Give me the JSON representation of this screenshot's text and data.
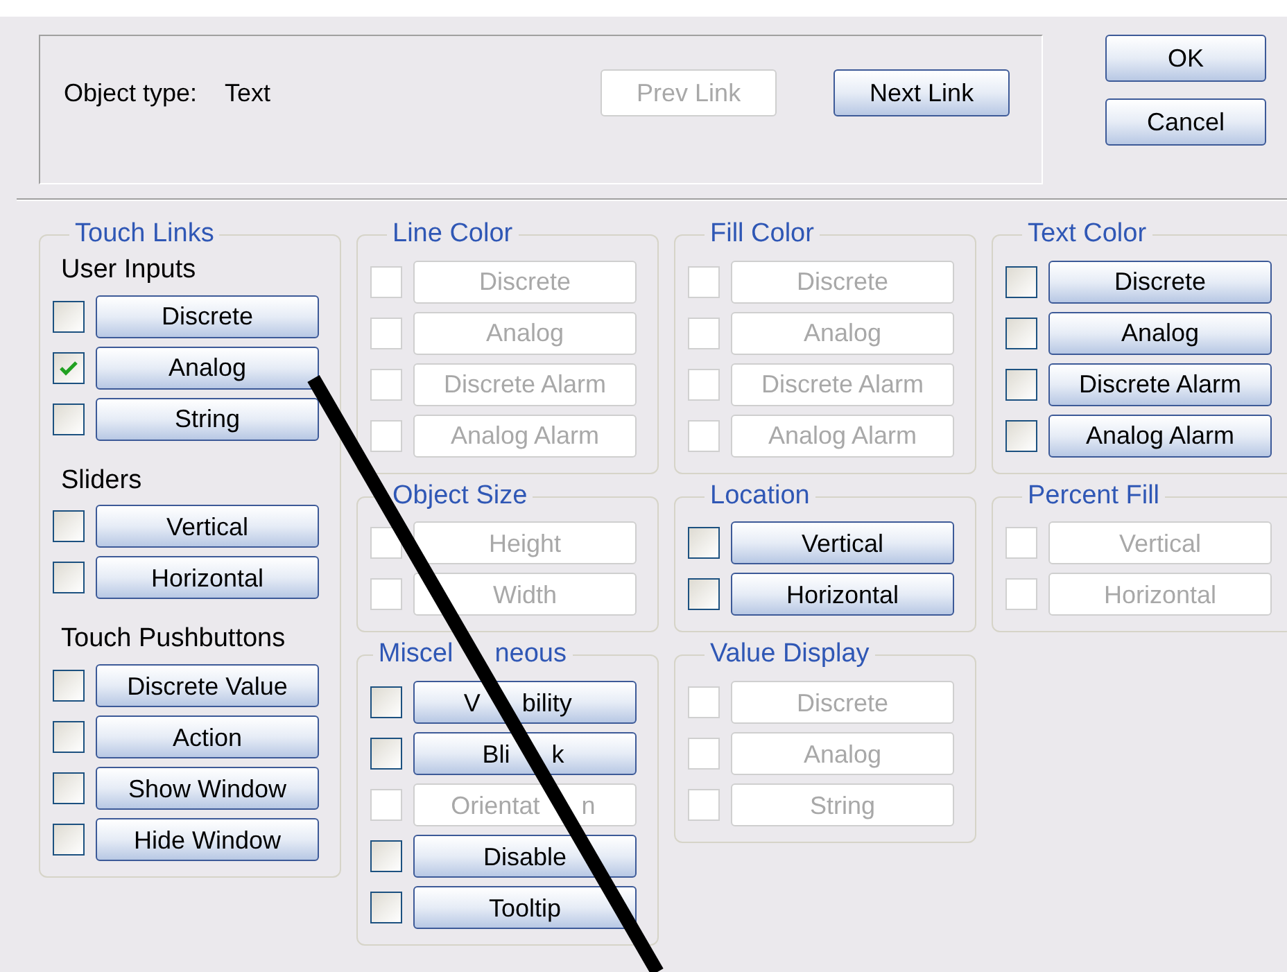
{
  "header": {
    "object_type_label": "Object type:",
    "object_type_value": "Text",
    "link_buttons": [
      {
        "label": "Prev Link",
        "disabled": true
      },
      {
        "label": "Next Link",
        "disabled": false
      }
    ]
  },
  "dialog_buttons": [
    "OK",
    "Cancel"
  ],
  "columns": [
    [
      {
        "title": "Touch Links",
        "sections": [
          {
            "heading": "User Inputs",
            "items": [
              {
                "label": "Discrete",
                "checked": false,
                "disabled": false
              },
              {
                "label": "Analog",
                "checked": true,
                "disabled": false
              },
              {
                "label": "String",
                "checked": false,
                "disabled": false
              }
            ]
          },
          {
            "heading": "Sliders",
            "items": [
              {
                "label": "Vertical",
                "checked": false,
                "disabled": false
              },
              {
                "label": "Horizontal",
                "checked": false,
                "disabled": false
              }
            ]
          },
          {
            "heading": "Touch Pushbuttons",
            "items": [
              {
                "label": "Discrete Value",
                "checked": false,
                "disabled": false
              },
              {
                "label": "Action",
                "checked": false,
                "disabled": false
              },
              {
                "label": "Show Window",
                "checked": false,
                "disabled": false
              },
              {
                "label": "Hide Window",
                "checked": false,
                "disabled": false
              }
            ]
          }
        ]
      }
    ],
    [
      {
        "title": "Line Color",
        "sections": [
          {
            "items": [
              {
                "label": "Discrete",
                "checked": false,
                "disabled": true
              },
              {
                "label": "Analog",
                "checked": false,
                "disabled": true
              },
              {
                "label": "Discrete Alarm",
                "checked": false,
                "disabled": true
              },
              {
                "label": "Analog Alarm",
                "checked": false,
                "disabled": true
              }
            ]
          }
        ]
      },
      {
        "title": "Object Size",
        "sections": [
          {
            "items": [
              {
                "label": "Height",
                "checked": false,
                "disabled": true
              },
              {
                "label": "Width",
                "checked": false,
                "disabled": true
              }
            ]
          }
        ]
      },
      {
        "title_parts": [
          "Miscel",
          "neous"
        ],
        "sections": [
          {
            "items": [
              {
                "label_parts": [
                  "V",
                  "bility"
                ],
                "checked": false,
                "disabled": false
              },
              {
                "label_parts": [
                  "Bli",
                  "k"
                ],
                "checked": false,
                "disabled": false
              },
              {
                "label_parts": [
                  "Orientat",
                  "n"
                ],
                "checked": false,
                "disabled": true
              },
              {
                "label": "Disable",
                "checked": false,
                "disabled": false
              },
              {
                "label": "Tooltip",
                "checked": false,
                "disabled": false
              }
            ]
          }
        ]
      }
    ],
    [
      {
        "title": "Fill Color",
        "sections": [
          {
            "items": [
              {
                "label": "Discrete",
                "checked": false,
                "disabled": true
              },
              {
                "label": "Analog",
                "checked": false,
                "disabled": true
              },
              {
                "label": "Discrete Alarm",
                "checked": false,
                "disabled": true
              },
              {
                "label": "Analog Alarm",
                "checked": false,
                "disabled": true
              }
            ]
          }
        ]
      },
      {
        "title": "Location",
        "sections": [
          {
            "items": [
              {
                "label": "Vertical",
                "checked": false,
                "disabled": false
              },
              {
                "label": "Horizontal",
                "checked": false,
                "disabled": false
              }
            ]
          }
        ]
      },
      {
        "title": "Value Display",
        "sections": [
          {
            "items": [
              {
                "label": "Discrete",
                "checked": false,
                "disabled": true
              },
              {
                "label": "Analog",
                "checked": false,
                "disabled": true
              },
              {
                "label": "String",
                "checked": false,
                "disabled": true
              }
            ]
          }
        ]
      }
    ],
    [
      {
        "title": "Text Color",
        "sections": [
          {
            "items": [
              {
                "label": "Discrete",
                "checked": false,
                "disabled": false
              },
              {
                "label": "Analog",
                "checked": false,
                "disabled": false
              },
              {
                "label": "Discrete Alarm",
                "checked": false,
                "disabled": false
              },
              {
                "label": "Analog Alarm",
                "checked": false,
                "disabled": false
              }
            ]
          }
        ]
      },
      {
        "title": "Percent Fill",
        "sections": [
          {
            "items": [
              {
                "label": "Vertical",
                "checked": false,
                "disabled": true
              },
              {
                "label": "Horizontal",
                "checked": false,
                "disabled": true
              }
            ]
          }
        ]
      }
    ]
  ]
}
